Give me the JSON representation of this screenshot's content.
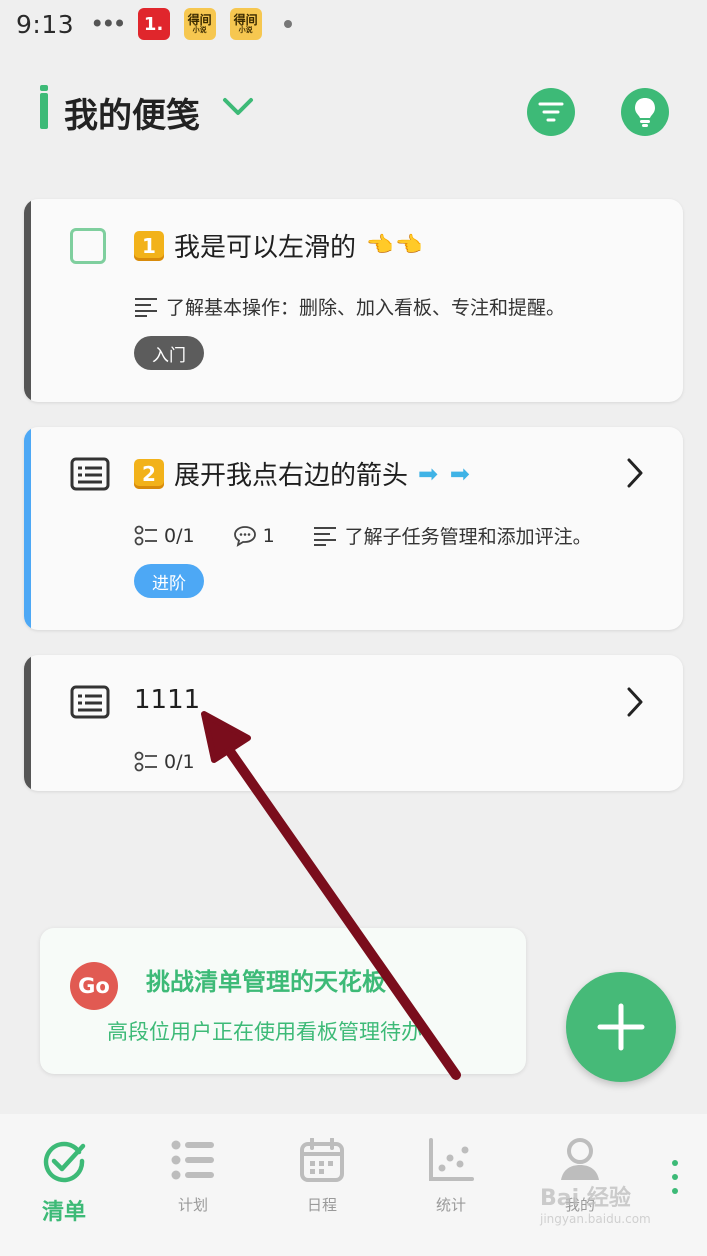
{
  "status_bar": {
    "time": "9:13",
    "dots": "•••",
    "app_badges": [
      {
        "text": "1.",
        "color": "#e0262c"
      },
      {
        "text": "得间",
        "sub": "小说",
        "color": "#f6c750"
      },
      {
        "text": "得间",
        "sub": "小说",
        "color": "#f6c750"
      }
    ]
  },
  "header": {
    "title": "我的便笺",
    "accent": "#3dba77",
    "actions": [
      "filter-icon",
      "lightbulb-icon"
    ]
  },
  "cards": [
    {
      "number": "1",
      "title": "我是可以左滑的",
      "emoji": "👈👈",
      "description": "了解基本操作：删除、加入看板、专注和提醒。",
      "tag": "入门",
      "tag_color": "#5c5c5c",
      "accent_color": "#555555"
    },
    {
      "number": "2",
      "title": "展开我点右边的箭头",
      "emoji": "➡ ➡",
      "subtasks": "0/1",
      "comments": "1",
      "description": "了解子任务管理和添加评注。",
      "tag": "进阶",
      "tag_color": "#4da8f5",
      "accent_color": "#4da8f5"
    },
    {
      "title": "1111",
      "subtasks": "0/1",
      "accent_color": "#555555"
    }
  ],
  "promo": {
    "logo": "Go",
    "title": "挑战清单管理的天花板",
    "subtitle": "高段位用户正在使用看板管理待办"
  },
  "fab": {
    "icon": "plus-icon",
    "color": "#46ba78"
  },
  "tabbar": {
    "tabs": [
      {
        "label": "清单",
        "icon": "check-circle-icon",
        "active": true
      },
      {
        "label": "计划",
        "icon": "list-icon",
        "active": false
      },
      {
        "label": "日程",
        "icon": "calendar-icon",
        "active": false
      },
      {
        "label": "统计",
        "icon": "chart-icon",
        "active": false
      },
      {
        "label": "我的",
        "icon": "user-icon",
        "active": false
      }
    ],
    "watermark": "Bai 经验",
    "watermark_sub": "jingyan.baidu.com"
  }
}
